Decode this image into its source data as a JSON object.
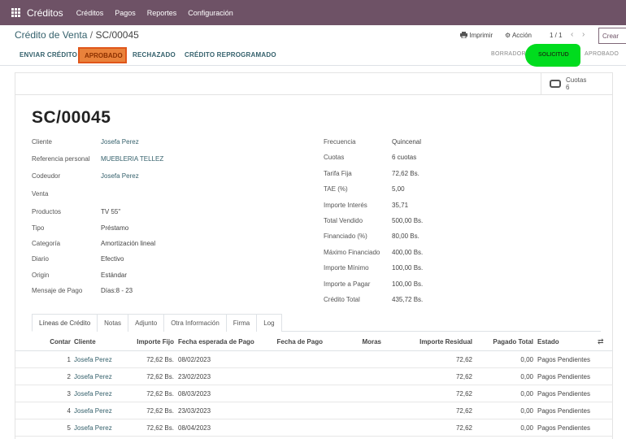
{
  "app": {
    "name": "Créditos"
  },
  "menu": [
    "Créditos",
    "Pagos",
    "Reportes",
    "Configuración"
  ],
  "breadcrumb": {
    "parent": "Crédito de Venta",
    "separator": "/",
    "current": "SC/00045"
  },
  "toolbar": {
    "print_label": "Imprimir",
    "action_label": "Acción",
    "print_icon": "printer-icon",
    "action_icon": "gear-icon"
  },
  "pager": {
    "value": "1 / 1",
    "prev": "‹",
    "next": "›"
  },
  "create_label": "Crear",
  "status_buttons": [
    "ENVIAR CRÉDITO",
    "APROBADO",
    "RECHAZADO",
    "CRÉDITO REPROGRAMADO"
  ],
  "stages": [
    "BORRADOR",
    "SOLICITUD",
    "APROBADO"
  ],
  "active_stage": "SOLICITUD",
  "smart_button": {
    "label": "Cuotas",
    "value": "6",
    "icon": "handshake-icon"
  },
  "record": {
    "title": "SC/00045"
  },
  "left_fields": [
    {
      "label": "Cliente",
      "value": "Josefa Perez",
      "link": true
    },
    {
      "label": "Referencia personal",
      "value": "MUEBLERIA TELLEZ",
      "link": true
    },
    {
      "label": "Codeudor",
      "value": "Josefa Perez",
      "link": true
    },
    {
      "label": "Venta",
      "value": "",
      "link": false
    },
    {
      "label": "Productos",
      "value": "TV 55\"",
      "link": false
    },
    {
      "label": "Tipo",
      "value": "Préstamo",
      "link": false
    },
    {
      "label": "Categoría",
      "value": "Amortización lineal",
      "link": false
    },
    {
      "label": "Diario",
      "value": "Efectivo",
      "link": false
    },
    {
      "label": "Origin",
      "value": "Estándar",
      "link": false
    },
    {
      "label": "Mensaje de Pago",
      "value": "Días:8 - 23",
      "link": false
    }
  ],
  "right_fields": [
    {
      "label": "Frecuencia",
      "value": "Quincenal"
    },
    {
      "label": "Cuotas",
      "value": "6 cuotas"
    },
    {
      "label": "Tarifa Fija",
      "value": "72,62 Bs."
    },
    {
      "label": "TAE (%)",
      "value": "5,00"
    },
    {
      "label": "Importe Interés",
      "value": "35,71"
    },
    {
      "label": "Total Vendido",
      "value": "500,00 Bs."
    },
    {
      "label": "Financiado (%)",
      "value": "80,00 Bs."
    },
    {
      "label": "Máximo Financiado",
      "value": "400,00 Bs."
    },
    {
      "label": "Importe Mínimo",
      "value": "100,00 Bs."
    },
    {
      "label": "Importe a Pagar",
      "value": "100,00 Bs."
    },
    {
      "label": "Crédito Total",
      "value": "435,72 Bs."
    }
  ],
  "tabs": [
    "Líneas de Crédito",
    "Notas",
    "Adjunto",
    "Otra Información",
    "Firma",
    "Log"
  ],
  "table": {
    "columns": [
      "Contar",
      "Cliente",
      "Importe Fijo",
      "Fecha esperada de Pago",
      "Fecha de Pago",
      "Moras",
      "Importe Residual",
      "Pagado Total",
      "Estado"
    ],
    "options_icon": "column-options-icon",
    "rows": [
      [
        "1",
        "Josefa Perez",
        "72,62 Bs.",
        "08/02/2023",
        "",
        "",
        "72,62",
        "0,00",
        "Pagos Pendientes"
      ],
      [
        "2",
        "Josefa Perez",
        "72,62 Bs.",
        "23/02/2023",
        "",
        "",
        "72,62",
        "0,00",
        "Pagos Pendientes"
      ],
      [
        "3",
        "Josefa Perez",
        "72,62 Bs.",
        "08/03/2023",
        "",
        "",
        "72,62",
        "0,00",
        "Pagos Pendientes"
      ],
      [
        "4",
        "Josefa Perez",
        "72,62 Bs.",
        "23/03/2023",
        "",
        "",
        "72,62",
        "0,00",
        "Pagos Pendientes"
      ],
      [
        "5",
        "Josefa Perez",
        "72,62 Bs.",
        "08/04/2023",
        "",
        "",
        "72,62",
        "0,00",
        "Pagos Pendientes"
      ]
    ]
  }
}
